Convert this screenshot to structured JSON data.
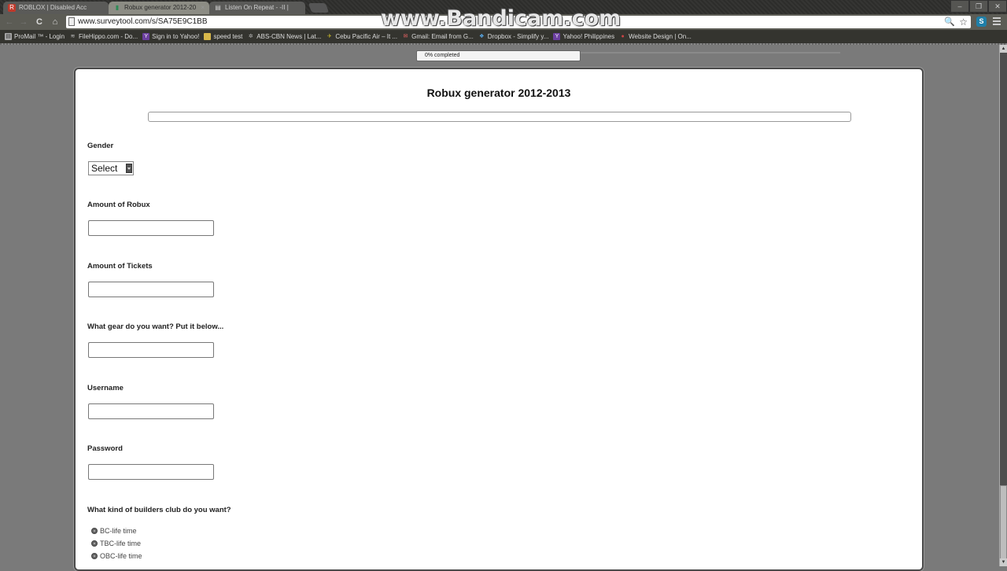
{
  "browser": {
    "tabs": [
      {
        "label": "ROBLOX | Disabled Acc",
        "icon": "roblox-icon",
        "glyph": "R",
        "color": "#c0392b"
      },
      {
        "label": "Robux generator 2012-20",
        "icon": "surveytool-icon",
        "glyph": "▮",
        "color": "#2e8b57",
        "close": "×"
      },
      {
        "label": "Listen On Repeat - -II |",
        "icon": "page-icon",
        "glyph": "▤",
        "color": "#ccc"
      }
    ],
    "window_controls": {
      "minimize": "–",
      "maximize": "❐",
      "close": "✕"
    },
    "nav": {
      "back": "←",
      "forward": "→",
      "reload": "C",
      "home": "⌂"
    },
    "url": "www.surveytool.com/s/SA75E9C1BB",
    "zoom_glyph": "🔍",
    "star_glyph": "☆",
    "skype_glyph": "S",
    "bookmarks": [
      {
        "label": "ProMail ™ - Login",
        "glyph": "▤",
        "color": "#aaa"
      },
      {
        "label": "FileHippo.com - Do...",
        "glyph": "≋",
        "color": "#888"
      },
      {
        "label": "Sign in to Yahoo!",
        "glyph": "Y",
        "color": "#6b3fa0"
      },
      {
        "label": "speed test",
        "glyph": "▭",
        "color": "#d8b84a"
      },
      {
        "label": "ABS-CBN News | Lat...",
        "glyph": "✲",
        "color": "#999"
      },
      {
        "label": "Cebu Pacific Air – It ...",
        "glyph": "✈",
        "color": "#c8b82a"
      },
      {
        "label": "Gmail: Email from G...",
        "glyph": "✉",
        "color": "#c44"
      },
      {
        "label": "Dropbox - Simplify y...",
        "glyph": "❖",
        "color": "#3a8fd8"
      },
      {
        "label": "Yahoo! Philippines",
        "glyph": "Y",
        "color": "#6b3fa0"
      },
      {
        "label": "Website Design | On...",
        "glyph": "●",
        "color": "#a33"
      }
    ]
  },
  "watermark": "www.Bandicam.com",
  "survey": {
    "progress_text": "0% completed",
    "progress_percent": 0,
    "title": "Robux generator 2012-2013",
    "questions": [
      {
        "label": "Gender",
        "type": "select",
        "value": "Select"
      },
      {
        "label": "Amount of Robux",
        "type": "text",
        "value": ""
      },
      {
        "label": "Amount of Tickets",
        "type": "text",
        "value": ""
      },
      {
        "label": "What gear do you want? Put it below...",
        "type": "text",
        "value": ""
      },
      {
        "label": "Username",
        "type": "text",
        "value": ""
      },
      {
        "label": "Password",
        "type": "text",
        "value": ""
      },
      {
        "label": "What kind of builders club do you want?",
        "type": "radio",
        "options": [
          "BC-life time",
          "TBC-life time",
          "OBC-life time"
        ]
      }
    ]
  }
}
